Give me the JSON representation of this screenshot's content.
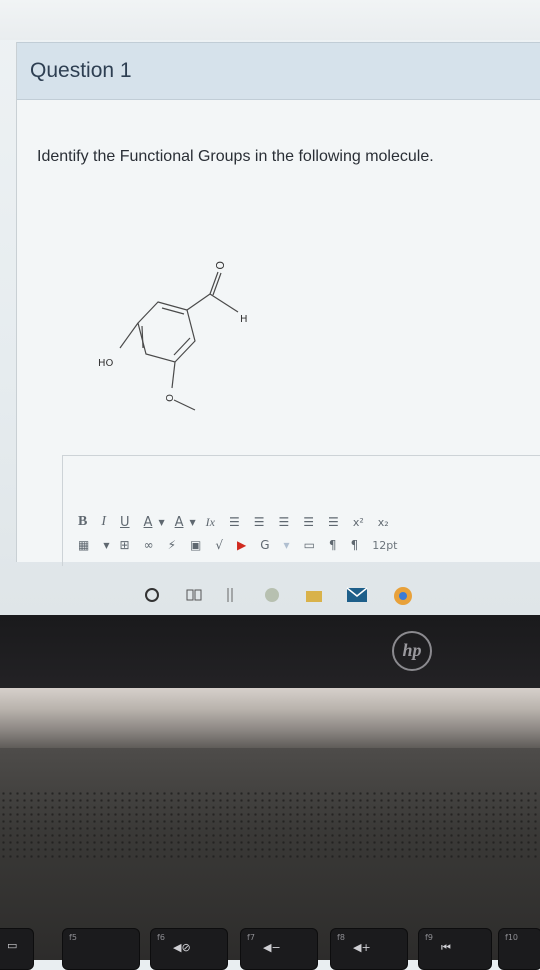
{
  "question": {
    "title": "Question 1",
    "prompt": "Identify the Functional Groups in the following molecule."
  },
  "molecule_labels": {
    "carbonyl_o": "O",
    "aldehyde_h": "H",
    "hydroxyl": "HO",
    "ether_o": "O"
  },
  "editor_toolbar": {
    "row1": [
      "B",
      "I",
      "U",
      "A",
      "A",
      "Ix",
      "x²",
      "x₂"
    ],
    "font_size": "12pt"
  },
  "keyboard": {
    "keys": [
      "f5",
      "f6",
      "f7",
      "f8",
      "f9",
      "f10"
    ]
  },
  "brand": "hp"
}
